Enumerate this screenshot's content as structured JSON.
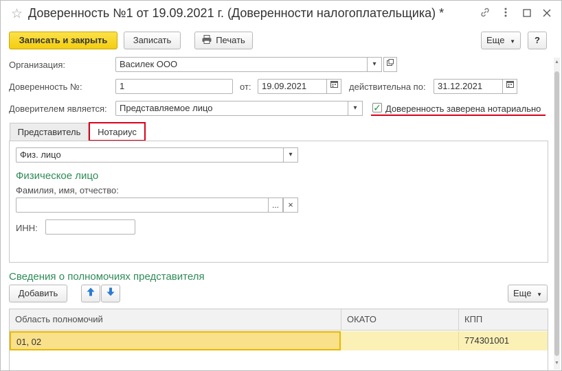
{
  "window": {
    "title": "Доверенность №1 от 19.09.2021 г. (Доверенности налогоплательщика) *"
  },
  "toolbar": {
    "save_close": "Записать и закрыть",
    "save": "Записать",
    "print": "Печать",
    "more": "Еще",
    "help": "?"
  },
  "form": {
    "org_label": "Организация:",
    "org_value": "Василек ООО",
    "number_label": "Доверенность №:",
    "number_value": "1",
    "from_label": "от:",
    "from_value": "19.09.2021",
    "valid_label": "действительна по:",
    "valid_value": "31.12.2021",
    "principal_label": "Доверителем является:",
    "principal_value": "Представляемое лицо",
    "notary_label": "Доверенность заверена нотариально",
    "notary_checked": true
  },
  "tabs": [
    {
      "label": "Представитель",
      "active": false
    },
    {
      "label": "Нотариус",
      "active": true
    }
  ],
  "notary": {
    "type_value": "Физ. лицо",
    "section_title": "Физическое лицо",
    "fio_label": "Фамилия, имя, отчество:",
    "fio_value": "",
    "select_btn": "...",
    "clear_btn": "×",
    "inn_label": "ИНН:",
    "inn_value": ""
  },
  "powers": {
    "section_title": "Сведения о полномочиях представителя",
    "add_btn": "Добавить",
    "more_btn": "Еще",
    "columns": [
      "Область полномочий",
      "ОКАТО",
      "КПП"
    ],
    "rows": [
      [
        "01, 02",
        "",
        "774301001"
      ]
    ]
  },
  "colors": {
    "accent_green": "#2e8b57",
    "primary_yellow": "#f4cd0e",
    "highlight_red": "#d9001b",
    "selected_row": "#fbf0b6",
    "selected_cell": "#f9e08a"
  }
}
